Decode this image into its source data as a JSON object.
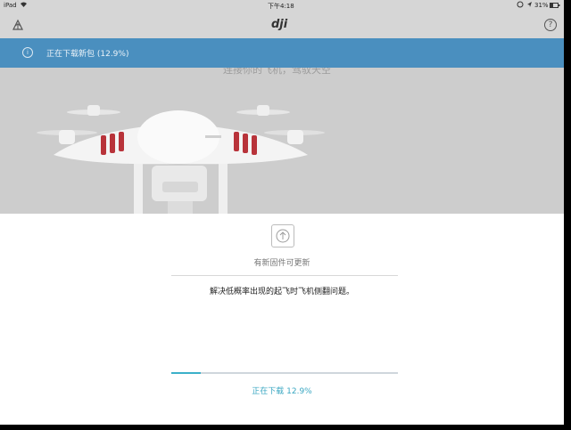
{
  "status_bar": {
    "device": "iPad",
    "time": "下午4:18",
    "battery": "31%"
  },
  "nav": {
    "logo": "dji",
    "help_symbol": "?"
  },
  "banner": {
    "info_symbol": "i",
    "text": "正在下载新包 (12.9%)"
  },
  "hero": {
    "caption": "连接你的飞机，驾驭天空"
  },
  "firmware": {
    "title": "有新固件可更新",
    "description": "解决低概率出现的起飞时飞机侧翻问题。",
    "progress_fraction": 0.129,
    "progress_text": "正在下载 12.9%"
  },
  "colors": {
    "banner": "#4a8fbf",
    "accent": "#3bb0c9",
    "drone_red": "#b8333a"
  }
}
